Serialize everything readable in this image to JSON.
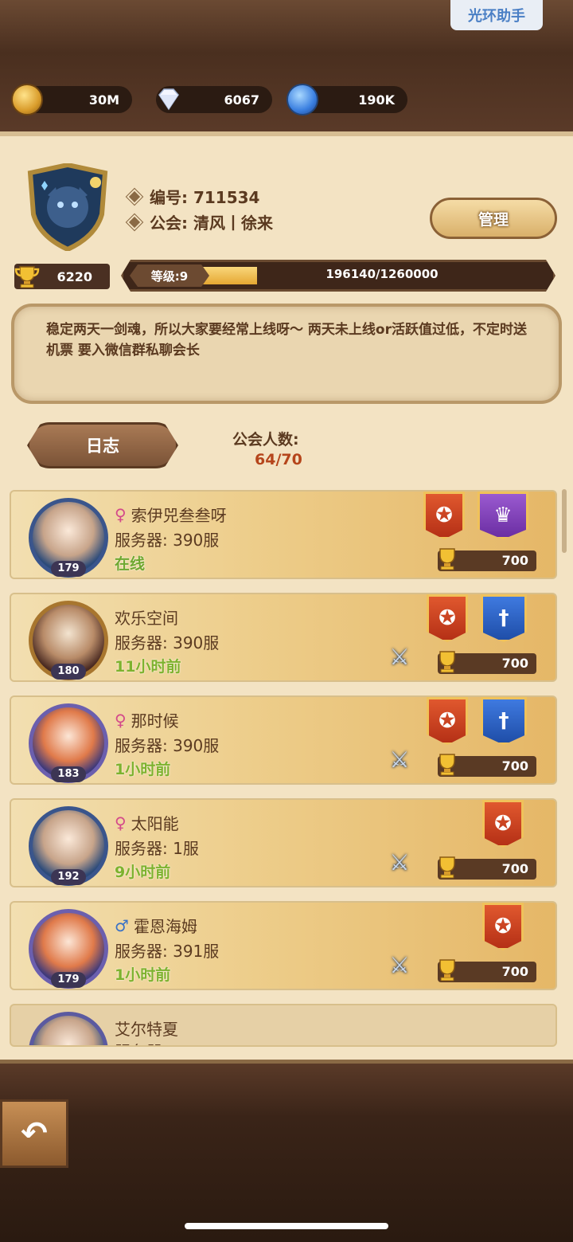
{
  "helper_button": "光环助手",
  "currencies": [
    {
      "icon": "gold-coin-icon",
      "value": "30M"
    },
    {
      "icon": "diamond-icon",
      "value": "6067"
    },
    {
      "icon": "magic-dust-icon",
      "value": "190K"
    }
  ],
  "guild": {
    "id_label": "编号: 711534",
    "leader_label": "公会: 清风丨徐来",
    "manage_button": "管理",
    "trophies": "6220",
    "level_label": "等级:9",
    "exp_text": "196140/1260000",
    "exp_progress": 0.155,
    "notice": "稳定两天一剑魂，所以大家要经常上线呀～ 两天未上线or活跃值过低，不定时送机票 要入微信群私聊会长",
    "log_button": "日志",
    "member_count_label": "公会人数:",
    "member_count": "64/70"
  },
  "members": [
    {
      "name": "索伊兕叁叁呀",
      "gender": "♀",
      "server": "服务器: 390服",
      "status": "在线",
      "level": "179",
      "score": "700",
      "banners": [
        "red",
        "purple"
      ],
      "swords": false
    },
    {
      "name": "欢乐空间",
      "gender": "",
      "server": "服务器: 390服",
      "status": "11小时前",
      "level": "180",
      "score": "700",
      "banners": [
        "red",
        "blue"
      ],
      "swords": true
    },
    {
      "name": "那时候",
      "gender": "♀",
      "server": "服务器: 390服",
      "status": "1小时前",
      "level": "183",
      "score": "700",
      "banners": [
        "red",
        "blue"
      ],
      "swords": true
    },
    {
      "name": "太阳能",
      "gender": "♀",
      "server": "服务器: 1服",
      "status": "9小时前",
      "level": "192",
      "score": "700",
      "banners": [
        "red"
      ],
      "swords": true
    },
    {
      "name": "霍恩海姆",
      "gender": "♂",
      "server": "服务器: 391服",
      "status": "1小时前",
      "level": "179",
      "score": "700",
      "banners": [
        "red"
      ],
      "swords": true
    },
    {
      "name": "艾尔特夏",
      "gender": "",
      "server": "服务器",
      "status": "",
      "level": "",
      "score": "",
      "banners": [],
      "swords": false
    }
  ],
  "back_button_icon": "back-arrow-icon"
}
